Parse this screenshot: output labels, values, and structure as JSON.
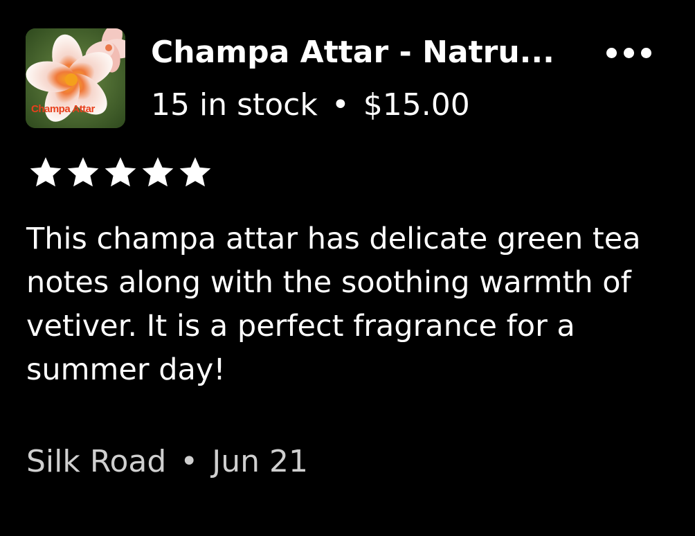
{
  "product": {
    "image_label": "Champa Attar",
    "title": "Champa Attar - Natru...",
    "stock": "15 in stock",
    "separator": "•",
    "price": "$15.00"
  },
  "more_menu_icon": "more-horizontal-icon",
  "rating": {
    "value": 5,
    "max": 5,
    "icon": "star-icon"
  },
  "review": {
    "text": "This champa attar has delicate green tea notes along with the soothing warmth of vetiver. It is a perfect fragrance for a summer day!"
  },
  "footer": {
    "author": "Silk Road",
    "separator": "•",
    "date": "Jun 21"
  },
  "colors": {
    "background": "#000000",
    "text": "#ffffff",
    "muted_text": "#cfcfcf",
    "image_label": "#e8401c"
  }
}
